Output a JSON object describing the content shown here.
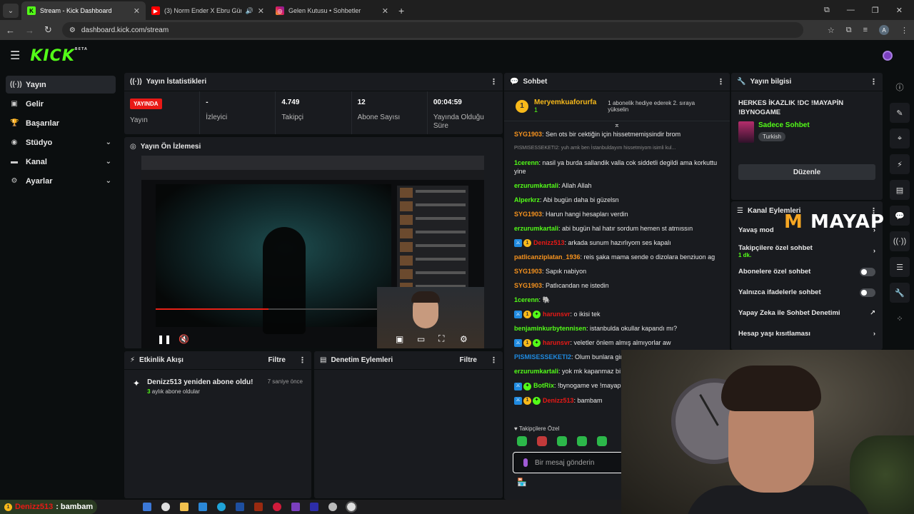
{
  "browser": {
    "tabs": [
      {
        "title": "Stream - Kick Dashboard",
        "icon": "kick-icon",
        "active": true
      },
      {
        "title": "(3) Norm Ender X Ebru Gün",
        "icon": "youtube-icon",
        "active": false
      },
      {
        "title": "Gelen Kutusu • Sohbetler",
        "icon": "instagram-icon",
        "active": false
      }
    ],
    "url": "dashboard.kick.com/stream",
    "profile_initial": "A"
  },
  "header": {
    "logo": "KICK",
    "logo_badge": "BETA"
  },
  "sidebar": {
    "items": [
      {
        "label": "Yayın",
        "icon": "broadcast-icon",
        "active": true,
        "expandable": false
      },
      {
        "label": "Gelir",
        "icon": "revenue-icon",
        "active": false,
        "expandable": false
      },
      {
        "label": "Başarılar",
        "icon": "trophy-icon",
        "active": false,
        "expandable": false
      },
      {
        "label": "Stüdyo",
        "icon": "studio-icon",
        "active": false,
        "expandable": true
      },
      {
        "label": "Kanal",
        "icon": "channel-icon",
        "active": false,
        "expandable": true
      },
      {
        "label": "Ayarlar",
        "icon": "settings-icon",
        "active": false,
        "expandable": true
      }
    ]
  },
  "stats": {
    "title": "Yayın İstatistikleri",
    "live_badge": "YAYINDA",
    "items": [
      {
        "value": "",
        "label": "Yayın"
      },
      {
        "value": "-",
        "label": "İzleyici"
      },
      {
        "value": "4.749",
        "label": "Takipçi"
      },
      {
        "value": "12",
        "label": "Abone Sayısı"
      },
      {
        "value": "00:04:59",
        "label": "Yayında Olduğu Süre"
      }
    ]
  },
  "preview": {
    "title": "Yayın Ön İzlemesi"
  },
  "activity": {
    "title": "Etkinlik Akışı",
    "filter": "Filtre",
    "items": [
      {
        "title": "Denizz513 yeniden abone oldu!",
        "months": "3",
        "sub": "aylık abone oldular",
        "time": "7 saniye önce"
      }
    ]
  },
  "moderation": {
    "title": "Denetim Eylemleri",
    "filter": "Filtre"
  },
  "chat": {
    "title": "Sohbet",
    "pinned": {
      "badge": "1",
      "user": "Meryemkuaforurfa",
      "sub_count": "1",
      "text": "1 abonelik hediye ederek 2. sıraya yükselin"
    },
    "messages": [
      {
        "user": "SYG1903",
        "color": "#f7931e",
        "text": ": Sen ots bir cektiğin için hissetmemişsindir brom",
        "badges": []
      },
      {
        "user": "",
        "color": "#8a8a8a",
        "text": "PISMISESSEKETI2: yuh amk ben İstanbuldayım hissetmiyom isimli kul...",
        "badges": [],
        "dim": true
      },
      {
        "user": "1cerenn",
        "color": "#53fc18",
        "text": ": nasil ya burda sallandik valla cok siddetli degildi ama korkuttu yine",
        "badges": []
      },
      {
        "user": "erzurumkartali",
        "color": "#53fc18",
        "text": ": Allah Allah",
        "badges": []
      },
      {
        "user": "Alperkrz",
        "color": "#53fc18",
        "text": ": Abi bugün daha bi güzelsn",
        "badges": []
      },
      {
        "user": "SYG1903",
        "color": "#f7931e",
        "text": ": Harun hangi hesapları verdin",
        "badges": []
      },
      {
        "user": "erzurumkartali",
        "color": "#53fc18",
        "text": ": abi bugün hal hatır sordum hemen st atmıssın",
        "badges": []
      },
      {
        "user": "Denizz513",
        "color": "#e91916",
        "text": ": arkada sunum hazırlıyom ses kapalı",
        "badges": [
          "blue",
          "gold"
        ]
      },
      {
        "user": "patlicanziplatan_1936",
        "color": "#f7931e",
        "text": ": reis şaka mama sende o dizolara benziuon ag",
        "badges": []
      },
      {
        "user": "SYG1903",
        "color": "#f7931e",
        "text": ": Sapık nabiyon",
        "badges": []
      },
      {
        "user": "SYG1903",
        "color": "#f7931e",
        "text": ": Patlıcandan ne istedin",
        "badges": []
      },
      {
        "user": "1cerenn",
        "color": "#53fc18",
        "text": ": 🐘",
        "badges": []
      },
      {
        "user": "harunsvr",
        "color": "#e91916",
        "text": ": o ikisi tek",
        "badges": [
          "blue",
          "gold",
          "green"
        ]
      },
      {
        "user": "benjaminkurbytennisen",
        "color": "#53fc18",
        "text": ": istanbulda okullar kapandı mı?",
        "badges": []
      },
      {
        "user": "harunsvr",
        "color": "#e91916",
        "text": ": veletler önlem almış almıyorlar aw",
        "badges": [
          "blue",
          "gold",
          "green"
        ]
      },
      {
        "user": "PISMISESSEKETI2",
        "color": "#1f8ae0",
        "text": ": Olum bunlara giri",
        "badges": []
      },
      {
        "user": "erzurumkartali",
        "color": "#53fc18",
        "text": ": yok mk kapanmaz bi",
        "badges": []
      },
      {
        "user": "BotRix",
        "color": "#53fc18",
        "text": ": !bynogame ve !mayap Yapabilirsiniz!",
        "badges": [
          "blue",
          "green"
        ]
      },
      {
        "user": "Denizz513",
        "color": "#e91916",
        "text": ": bambam",
        "badges": [
          "blue",
          "gold",
          "green"
        ]
      }
    ],
    "followers_only": "Takipçilere Özel",
    "input_placeholder": "Bir mesaj gönderin"
  },
  "stream_info": {
    "title": "Yayın bilgisi",
    "stream_title": "HERKES İKAZLIK !DC !MAYAPİN !BYNOGAME",
    "category": "Sadece Sohbet",
    "language": "Turkish",
    "edit": "Düzenle"
  },
  "channel_actions": {
    "title": "Kanal Eylemleri",
    "items": [
      {
        "label": "Yavaş mod",
        "control": "arrow"
      },
      {
        "label": "Takipçilere özel sohbet",
        "sub": "1 dk.",
        "control": "arrow"
      },
      {
        "label": "Abonelere özel sohbet",
        "control": "toggle"
      },
      {
        "label": "Yalnızca ifadelerle sohbet",
        "control": "toggle"
      },
      {
        "label": "Yapay Zeka ile Sohbet Denetimi",
        "control": "external"
      },
      {
        "label": "Hesap yaşı kısıtlaması",
        "control": "arrow"
      }
    ],
    "overlay_brand": "MAYAPİN"
  },
  "ticker": {
    "user": "Denizz513",
    "message": ": bambam"
  },
  "colors": {
    "brand": "#53fc18",
    "live": "#e91916",
    "panel": "#191b1f"
  }
}
